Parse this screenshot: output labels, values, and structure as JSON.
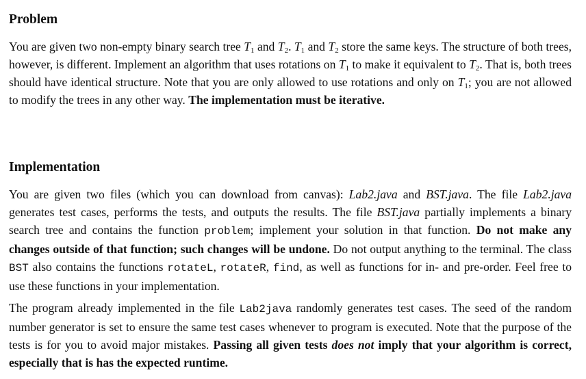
{
  "problem": {
    "heading": "Problem",
    "paragraph": [
      {
        "t": "n",
        "v": "You are given two non-empty binary search tree "
      },
      {
        "t": "math",
        "v": "T",
        "sub": "1"
      },
      {
        "t": "n",
        "v": " and "
      },
      {
        "t": "math",
        "v": "T",
        "sub": "2"
      },
      {
        "t": "n",
        "v": ". "
      },
      {
        "t": "math",
        "v": "T",
        "sub": "1"
      },
      {
        "t": "n",
        "v": " and "
      },
      {
        "t": "math",
        "v": "T",
        "sub": "2"
      },
      {
        "t": "n",
        "v": " store the same keys. The structure of both trees, however, is different. Implement an algorithm that uses rotations on "
      },
      {
        "t": "math",
        "v": "T",
        "sub": "1"
      },
      {
        "t": "n",
        "v": " to make it equivalent to "
      },
      {
        "t": "math",
        "v": "T",
        "sub": "2"
      },
      {
        "t": "n",
        "v": ". That is, both trees should have identical structure. Note that you are only allowed to use rotations and only on "
      },
      {
        "t": "math",
        "v": "T",
        "sub": "1"
      },
      {
        "t": "n",
        "v": "; you are not allowed to modify the trees in any other way. "
      },
      {
        "t": "b",
        "v": "The implementation must be iterative."
      }
    ]
  },
  "implementation": {
    "heading": "Implementation",
    "paragraph1": [
      {
        "t": "n",
        "v": "You are given two files (which you can download from canvas): "
      },
      {
        "t": "i",
        "v": "Lab2.java"
      },
      {
        "t": "n",
        "v": " and "
      },
      {
        "t": "i",
        "v": "BST.java"
      },
      {
        "t": "n",
        "v": ". The file "
      },
      {
        "t": "i",
        "v": "Lab2.java"
      },
      {
        "t": "n",
        "v": " generates test cases, performs the tests, and outputs the results. The file "
      },
      {
        "t": "i",
        "v": "BST.java"
      },
      {
        "t": "n",
        "v": " partially implements a binary search tree and contains the function "
      },
      {
        "t": "m",
        "v": "problem"
      },
      {
        "t": "n",
        "v": "; implement your solution in that function. "
      },
      {
        "t": "b",
        "v": "Do not make any changes outside of that function; such changes will be undone."
      },
      {
        "t": "n",
        "v": " Do not output anything to the terminal. The class "
      },
      {
        "t": "m",
        "v": "BST"
      },
      {
        "t": "n",
        "v": " also contains the functions "
      },
      {
        "t": "m",
        "v": "rotateL"
      },
      {
        "t": "n",
        "v": ", "
      },
      {
        "t": "m",
        "v": "rotateR"
      },
      {
        "t": "n",
        "v": ", "
      },
      {
        "t": "m",
        "v": "find"
      },
      {
        "t": "n",
        "v": ", as well as functions for in- and pre-order. Feel free to use these functions in your implementation."
      }
    ],
    "paragraph2": [
      {
        "t": "n",
        "v": "The program already implemented in the file "
      },
      {
        "t": "m",
        "v": "Lab2java"
      },
      {
        "t": "n",
        "v": " randomly generates test cases. The seed of the random number generator is set to ensure the same test cases whenever to program is executed. Note that the purpose of the tests is for you to avoid major mistakes. "
      },
      {
        "t": "b",
        "v": "Passing all given tests "
      },
      {
        "t": "bi",
        "v": "does not"
      },
      {
        "t": "b",
        "v": " imply that your algorithm is correct, especially that is has the expected runtime."
      }
    ]
  }
}
